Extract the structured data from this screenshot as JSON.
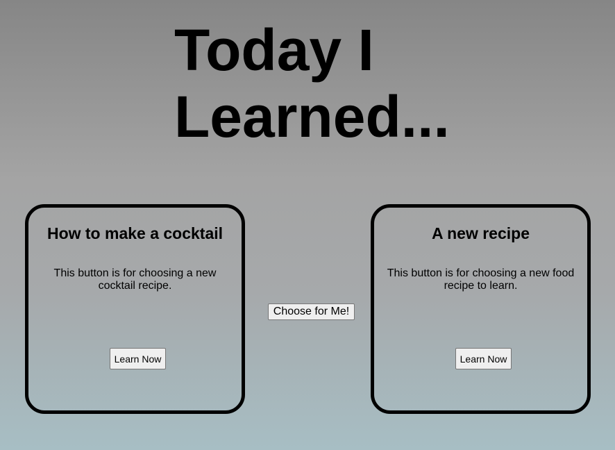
{
  "header": {
    "title": "Today I Learned..."
  },
  "cards": [
    {
      "title": "How to make a cocktail",
      "description": "This button is for choosing a new cocktail recipe.",
      "button_label": "Learn Now"
    },
    {
      "title": "A new recipe",
      "description": "This button is for choosing a new food recipe to learn.",
      "button_label": "Learn Now"
    }
  ],
  "center": {
    "choose_label": "Choose for Me!"
  },
  "colors": {
    "background_top": "#868686",
    "background_bottom": "#a7bec4",
    "border": "#000000",
    "button_bg": "#efefef"
  }
}
